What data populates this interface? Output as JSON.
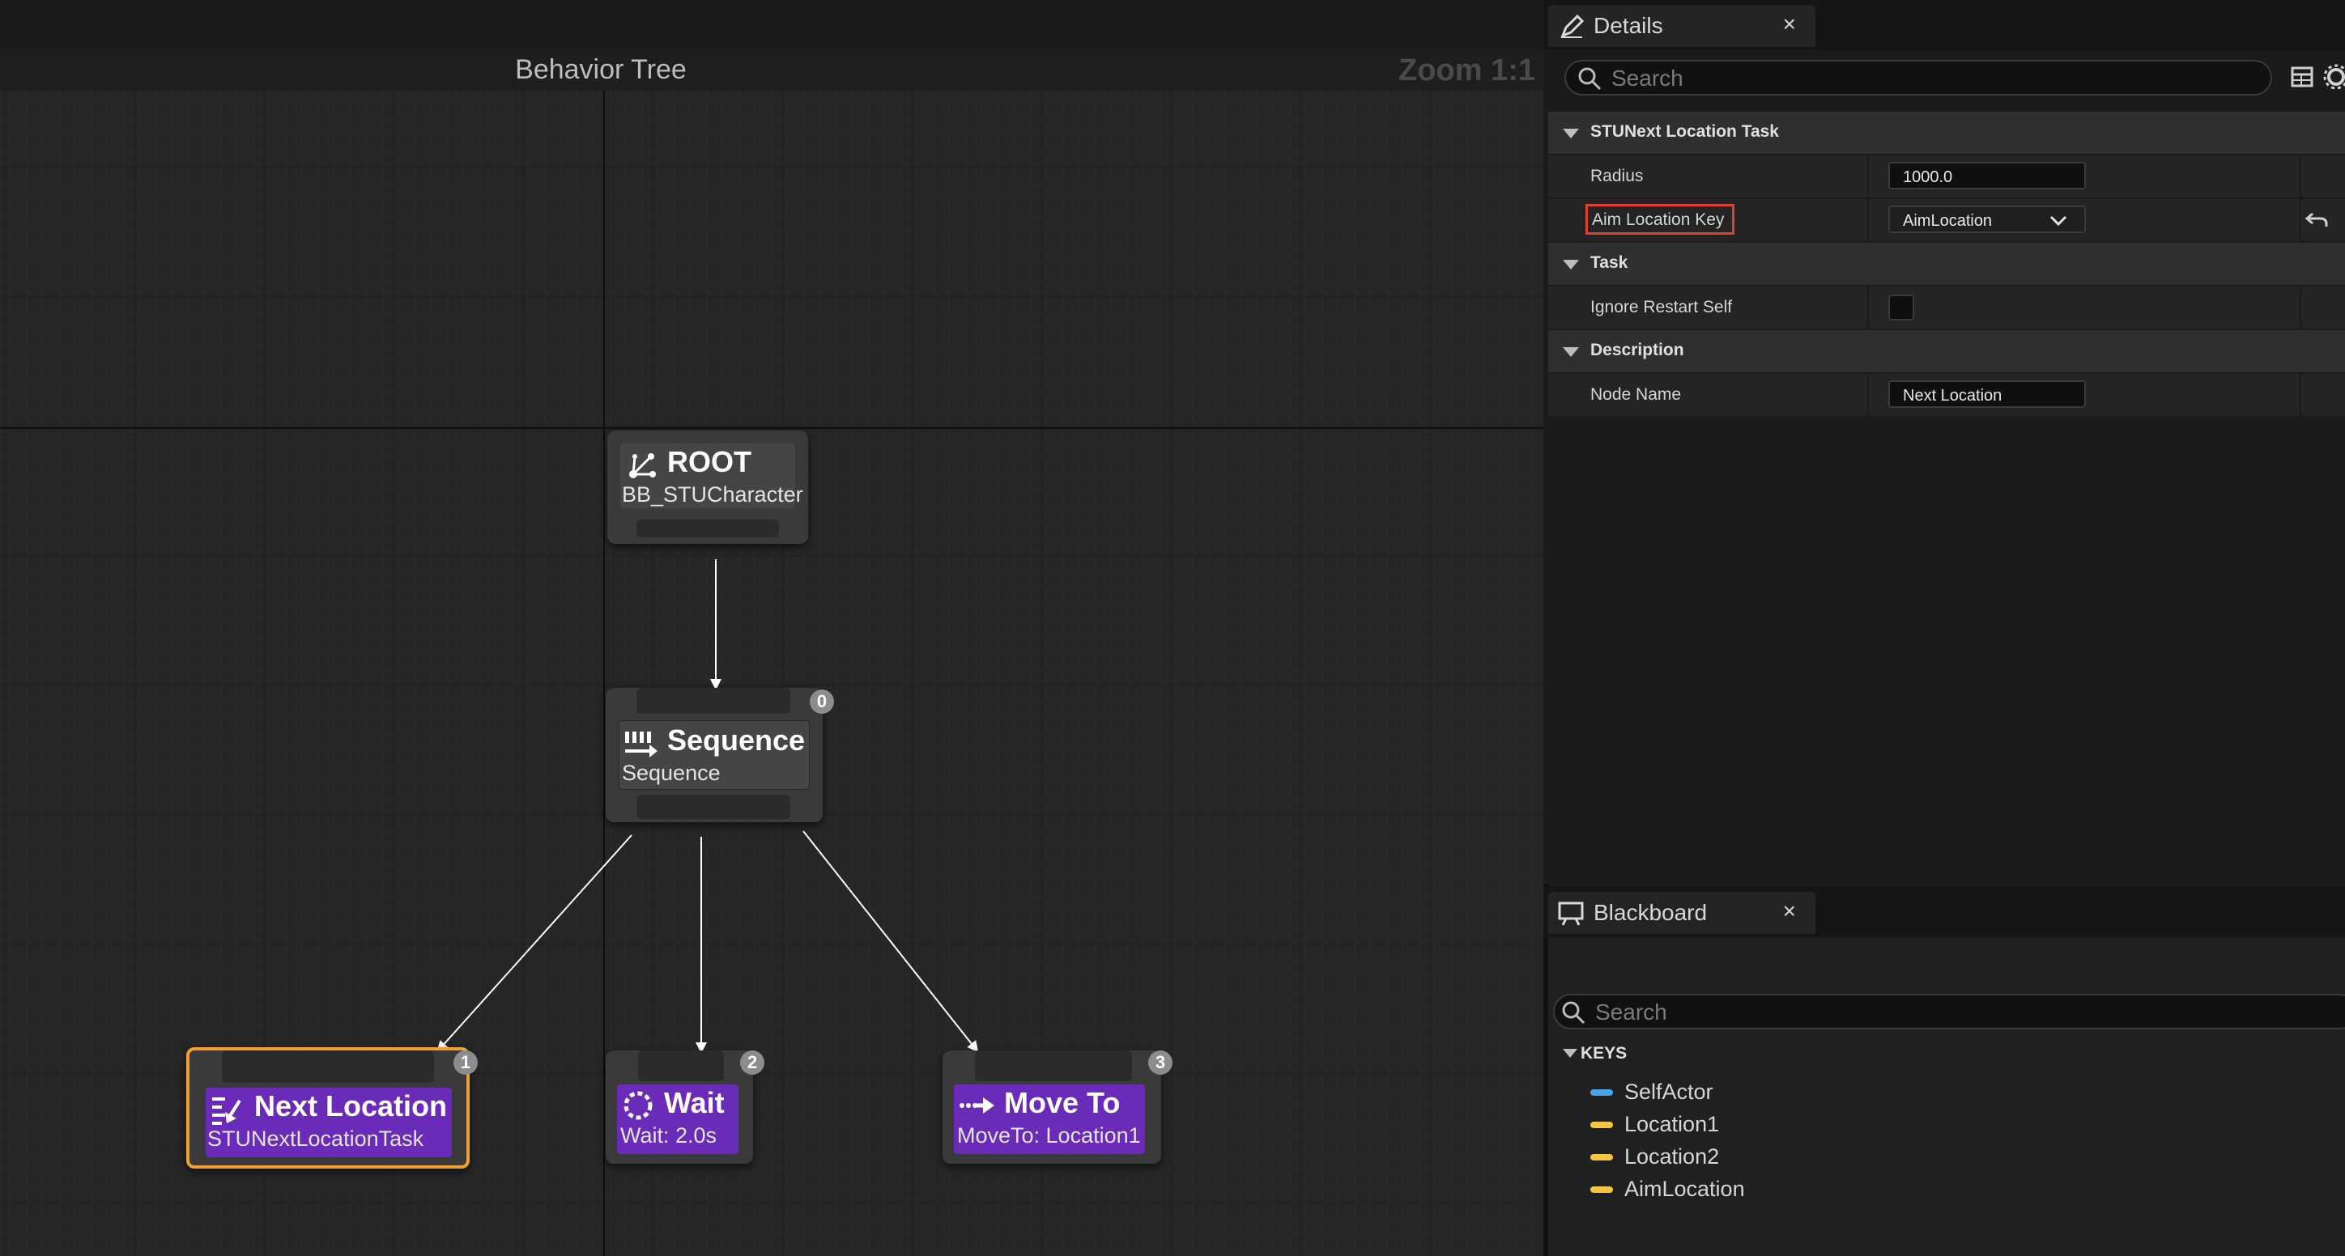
{
  "graph": {
    "title": "Behavior Tree",
    "zoom": "Zoom 1:1",
    "nodes": {
      "root": {
        "title": "ROOT",
        "subtitle": "BB_STUCharacter"
      },
      "sequence": {
        "title": "Sequence",
        "subtitle": "Sequence",
        "index": "0"
      },
      "next_location": {
        "title": "Next Location",
        "subtitle": "STUNextLocationTask",
        "index": "1"
      },
      "wait": {
        "title": "Wait",
        "subtitle": "Wait: 2.0s",
        "index": "2"
      },
      "move_to": {
        "title": "Move To",
        "subtitle": "MoveTo: Location1",
        "index": "3"
      }
    }
  },
  "details": {
    "tab_label": "Details",
    "close": "×",
    "search_placeholder": "Search",
    "categories": [
      {
        "label": "STUNext Location Task",
        "rows": [
          {
            "label": "Radius",
            "value": "1000.0"
          },
          {
            "label": "Aim Location Key",
            "value": "AimLocation"
          }
        ]
      },
      {
        "label": "Task",
        "rows": [
          {
            "label": "Ignore Restart Self",
            "value": ""
          }
        ]
      },
      {
        "label": "Description",
        "rows": [
          {
            "label": "Node Name",
            "value": "Next Location"
          }
        ]
      }
    ]
  },
  "blackboard": {
    "tab_label": "Blackboard",
    "close": "×",
    "search_placeholder": "Search",
    "keys_header": "KEYS",
    "keys": [
      {
        "name": "SelfActor",
        "color": "#4aa3e8"
      },
      {
        "name": "Location1",
        "color": "#f5c542"
      },
      {
        "name": "Location2",
        "color": "#f5c542"
      },
      {
        "name": "AimLocation",
        "color": "#f5c542"
      }
    ]
  },
  "colors": {
    "task_node": "#6a2bb8",
    "selected_outline": "#f0a030",
    "highlight_box": "#e0402a"
  }
}
